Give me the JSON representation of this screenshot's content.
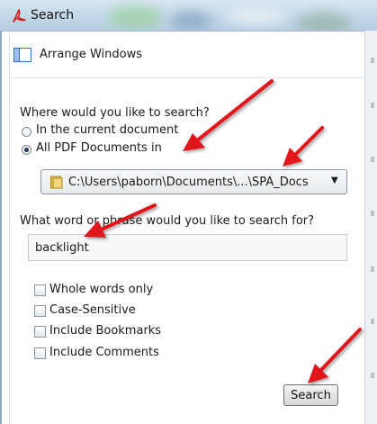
{
  "window": {
    "title": "Search",
    "title_icon": "acrobat-icon"
  },
  "panel": {
    "arrange_label": "Arrange Windows",
    "arrange_icon": "arrange-windows-icon",
    "where_question": "Where would you like to search?",
    "radio_current": "In the current document",
    "radio_all": "All PDF Documents in",
    "selected_scope": "All PDF Documents in",
    "location_value": "C:\\Users\\paborn\\Documents\\...\\SPA_Docs",
    "what_question": "What word or phrase would you like to search for?",
    "search_term": "backlight",
    "options": [
      {
        "label": "Whole words only",
        "checked": false
      },
      {
        "label": "Case-Sensitive",
        "checked": false
      },
      {
        "label": "Include Bookmarks",
        "checked": false
      },
      {
        "label": "Include Comments",
        "checked": false
      }
    ],
    "search_button": "Search"
  },
  "annotations": {
    "arrow_color": "#e0181b",
    "arrow_count": 5
  }
}
